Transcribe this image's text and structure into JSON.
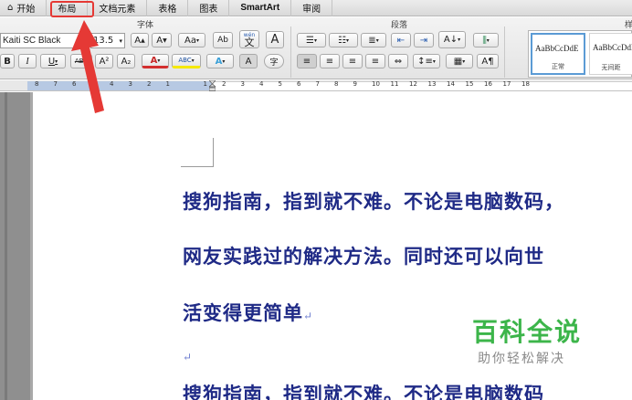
{
  "tabs": [
    {
      "id": "home",
      "label": "开始"
    },
    {
      "id": "layout",
      "label": "布局"
    },
    {
      "id": "document_elements",
      "label": "文档元素"
    },
    {
      "id": "tables",
      "label": "表格"
    },
    {
      "id": "charts",
      "label": "图表"
    },
    {
      "id": "smartart",
      "label": "SmartArt"
    },
    {
      "id": "review",
      "label": "审阅"
    }
  ],
  "ribbon": {
    "font_group_title": "字体",
    "paragraph_group_title": "段落",
    "styles_group_title": "样",
    "font_name": "Kaiti SC Black",
    "font_size": "13.5",
    "grow_font": "A",
    "shrink_font": "A",
    "change_case": "Aa",
    "clear_format": "Ab",
    "phonetic_top": "wén",
    "phonetic_char": "文",
    "char_border": "A",
    "bold": "B",
    "italic": "I",
    "underline": "U",
    "strike": "ABC",
    "superscript": "A²",
    "subscript": "A₂",
    "font_color": "A",
    "highlight": "ABC",
    "text_effects": "A",
    "char_shading": "A",
    "enclose": "字",
    "styles": [
      {
        "sample": "AaBbCcDdE",
        "name": "正常"
      },
      {
        "sample": "AaBbCcDdE",
        "name": "无间距"
      }
    ]
  },
  "ruler": {
    "numbers": [
      "8",
      "7",
      "6",
      "5",
      "4",
      "3",
      "2",
      "1",
      "",
      "1",
      "2",
      "3",
      "4",
      "5",
      "6",
      "7",
      "8",
      "9",
      "10",
      "11",
      "12",
      "13",
      "14",
      "15",
      "16",
      "17",
      "18"
    ]
  },
  "document": {
    "lines": [
      "搜狗指南，指到就不难。不论是电脑数码，",
      "网友实践过的解决方法。同时还可以向世",
      "活变得更简单",
      "",
      "搜狗指南，指到就不难。不论是电脑数码"
    ],
    "return_mark": "↵"
  },
  "watermark": {
    "title": "百科全说",
    "subtitle": "助你轻松解决"
  },
  "colors": {
    "text_blue": "#1f2a86",
    "highlight_red": "#e53935",
    "watermark_green": "#3cb54a"
  }
}
